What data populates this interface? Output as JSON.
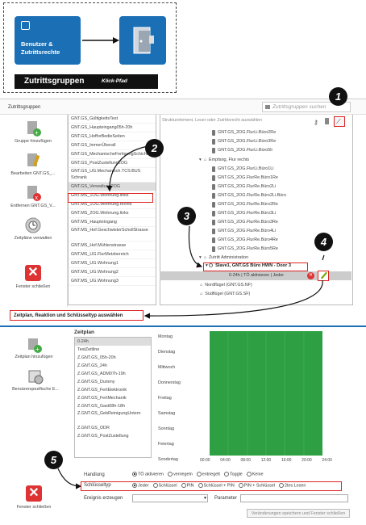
{
  "illustration": {
    "source_label": "Benutzer & Zutrittsrechte",
    "bar_title": "Zutrittsgruppen",
    "bar_subtitle": "Klick-Pfad"
  },
  "window": {
    "title": "Zutrittsgruppen",
    "search_placeholder": "Zutrittsgruppen suchen"
  },
  "sidebar_top": [
    {
      "label": "Gruppe hinzufügen"
    },
    {
      "label": "Bearbeiten GNT.GS_..."
    },
    {
      "label": "Entfernen GNT.GS_V..."
    },
    {
      "label": "Zeitpläne verwalten"
    },
    {
      "label": "Fenster schließen"
    }
  ],
  "groups": [
    "GNT.GS_GültigkeitsTest",
    "GNT.GS_Haupteingang05h-20h",
    "GNT.GS_HofforBedieSeiten",
    "GNT.GS_ImmerÜberall",
    "GNT.GS_MechanischeFertigungSchicht",
    "GNT.GS_PostZustellung2OG",
    "GNT.GS_UG.Mechanisch.TCS:BUS Schrank",
    "GNT.GS_Verwaltung2OG",
    "GNT.MS_1OG.Wohnung.links",
    "GNT.MS_1OG.Wohnung.rechts",
    "GNT.MS_2OG.Wohnung.links",
    "GNT.MS_Haupteingang",
    "GNT.MS_Hof.GeschwisterSchollStrasse",
    "GNT.MS_Hof.Mühlenstrasse",
    "GNT.MS_UG.FlurMetzbereich",
    "GNT.MS_UG.Wohnung1",
    "GNT.MS_UG.Wohnung2",
    "GNT.MS_UG.Wohnung3"
  ],
  "tree": {
    "filter_placeholder": "Strukturelement, Leser oder Zutrittsrecht auswählen",
    "items_a": [
      "GNT.GS_2OG.FlurLi.Büro2Re",
      "GNT.GS_2OG.FlurLi.Büro3Re",
      "GNT.GS_2OG.FlurLi.Büro5li"
    ],
    "group_empfang": "Empfang, Flur rechts",
    "items_b": [
      "GNT.GS_2OG.FlurLi.Büro1Li",
      "GNT.GS_2OG.FlurRe.Büro1Re",
      "GNT.GS_2OG.FlurRe.Büro2Li",
      "GNT.GS_2OG.FlurRe.Büro2Li.Büro",
      "GNT.GS_2OG.FlurRe.Büro2Re",
      "GNT.GS_2OG.FlurRe.Büro3Li",
      "GNT.GS_2OG.FlurRe.Büro3Re",
      "GNT.GS_2OG.FlurRe.Büro4Li",
      "GNT.GS_2OG.FlurRe.Büro4Re",
      "GNT.GS_2OG.FlurRe.Büro5Re"
    ],
    "group_admin": "Zutritt Administration",
    "door_label": "Slave1, GNT.GS Büro HWN - Door 3",
    "rule_label": "0-24h | TÖ aktivieren | Jeder",
    "nordflugel": "Nordflügel (GNT.GS.NF)",
    "sudflugel": "Südflügel (GNT.GS.SF)"
  },
  "annotation_label": "Zeitplan, Reaktion und Schlüsseltyp auswählen",
  "callouts": [
    "1",
    "2",
    "3",
    "4",
    "5"
  ],
  "schedule": {
    "header": "Zeitplan",
    "items": [
      "0-24h",
      "TestZeitline",
      "Z.GNT.GS_05h-20h",
      "Z.GNT.GS_24h",
      "Z.GNT.GS_ADM07h-19h",
      "Z.GNT.GS_Dummy",
      "Z.GNT.GS_FertElektronik",
      "Z.GNT.GS_FertMechanik",
      "Z.GNT.GS_Gast08h-18h",
      "Z.GNT.GS_GebReinigungUntern",
      "Z.GNT.GS_ODR",
      "Z.GNT.GS_PostZustellung"
    ],
    "days": [
      "Montag",
      "Dienstag",
      "Mittwoch",
      "Donnerstag",
      "Freitag",
      "Samstag",
      "Sonntag",
      "Feiertag",
      "Sondertag"
    ],
    "times": [
      "00:00",
      "04:00",
      "08:00",
      "12:00",
      "16:00",
      "20:00",
      "24:00"
    ]
  },
  "sidebar_bottom": [
    {
      "label": "Zeitplan hinzufügen"
    },
    {
      "label": "Benutzerspezifische E..."
    },
    {
      "label": "Fenster schließen"
    }
  ],
  "handlung": {
    "label": "Handlung",
    "options": [
      "TÖ aktivieren",
      "verriegeln",
      "entriegelt",
      "Toggle",
      "Keine"
    ]
  },
  "schluesseltyp": {
    "label": "Schlüsseltyp",
    "options": [
      "Jeder",
      "Schlüssel",
      "PIN",
      "Schlüssel + PIN",
      "PIN + Schlüssel",
      "2tes Lesen"
    ]
  },
  "ereignis": {
    "label": "Ereignis erzeugen",
    "param_label": "Parameter"
  },
  "save_button": "Veränderungen speichern und Fenster schließen",
  "colors": {
    "accent": "#1a6fb5",
    "highlight": "#d22222",
    "schedule_fill": "#2ea043"
  }
}
